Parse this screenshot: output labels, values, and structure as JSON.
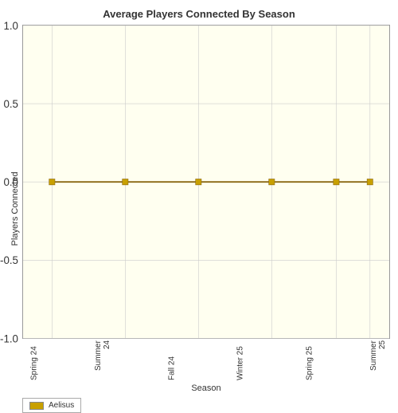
{
  "chart": {
    "title": "Average Players Connected By Season",
    "y_axis_label": "Players Connected",
    "x_axis_label": "Season",
    "y_ticks": [
      "1.0",
      "0.5",
      "0.0",
      "-0.5",
      "-1.0"
    ],
    "x_ticks": [
      "Spring 24",
      "Summer 24",
      "Fall 24",
      "Winter 25",
      "Spring 25",
      "Summer 25"
    ],
    "legend": [
      {
        "label": "Aelisus",
        "color": "#c8a000"
      }
    ],
    "data_points": [
      {
        "season": "Spring 24",
        "value": 0.0
      },
      {
        "season": "Summer 24",
        "value": 0.0
      },
      {
        "season": "Fall 24",
        "value": 0.0
      },
      {
        "season": "Winter 25",
        "value": 0.0
      },
      {
        "season": "Spring 25",
        "value": 0.0
      },
      {
        "season": "Summer 25",
        "value": 0.0
      }
    ],
    "y_min": -1.0,
    "y_max": 1.0
  }
}
